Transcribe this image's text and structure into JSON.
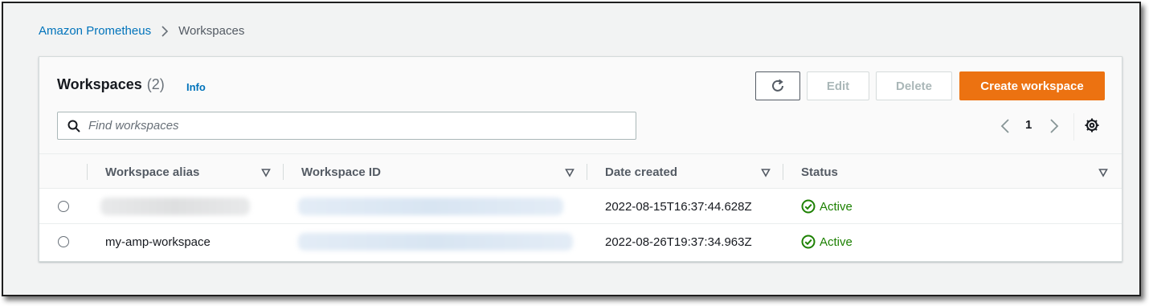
{
  "breadcrumb": {
    "parent": "Amazon Prometheus",
    "current": "Workspaces"
  },
  "header": {
    "title": "Workspaces",
    "count": "(2)",
    "info": "Info"
  },
  "actions": {
    "refresh_icon": "refresh-icon",
    "edit": "Edit",
    "delete": "Delete",
    "create": "Create workspace"
  },
  "search": {
    "placeholder": "Find workspaces",
    "value": ""
  },
  "pagination": {
    "current_page": "1"
  },
  "table": {
    "columns": [
      "Workspace alias",
      "Workspace ID",
      "Date created",
      "Status"
    ],
    "rows": [
      {
        "alias": "",
        "workspace_id": "",
        "date_created": "2022-08-15T16:37:44.628Z",
        "status": "Active"
      },
      {
        "alias": "my-amp-workspace",
        "workspace_id": "",
        "date_created": "2022-08-26T19:37:34.963Z",
        "status": "Active"
      }
    ]
  },
  "colors": {
    "link": "#0073bb",
    "primary": "#ec7211",
    "success": "#1d8102",
    "disabled": "#aab7b8"
  }
}
